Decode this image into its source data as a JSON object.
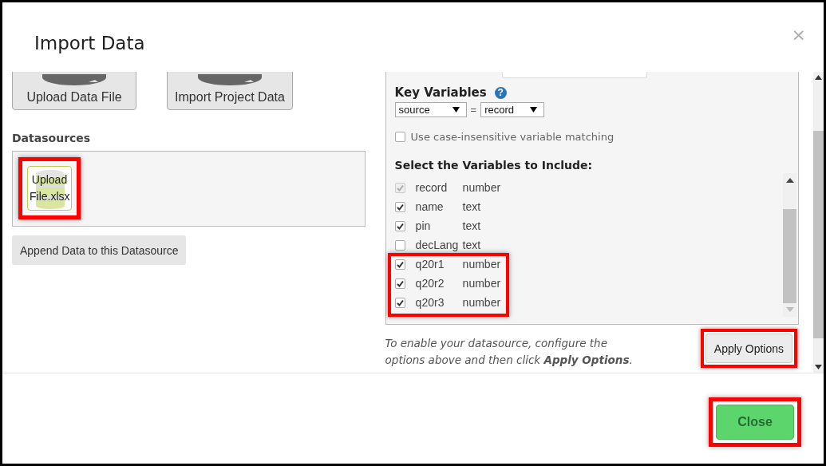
{
  "dialog": {
    "title": "Import Data",
    "close_icon": "×"
  },
  "import_buttons": [
    {
      "label": "Upload Data File"
    },
    {
      "label": "Import Project Data"
    }
  ],
  "datasources": {
    "heading": "Datasources",
    "items": [
      {
        "label": "Upload File.xlsx",
        "highlighted": true
      }
    ],
    "append_button": "Append Data to this Datasource"
  },
  "options": {
    "key_variables": {
      "label": "Key Variables",
      "help_icon": "?",
      "left": "source",
      "operator": "=",
      "right": "record"
    },
    "case_insensitive": {
      "label": "Use case-insensitive variable matching",
      "checked": false
    },
    "variables_heading": "Select the Variables to Include:",
    "variable_groups": [
      {
        "highlighted": false,
        "variables": [
          {
            "name": "record",
            "type": "number",
            "checked": true,
            "disabled": true
          },
          {
            "name": "name",
            "type": "text",
            "checked": true,
            "disabled": false
          },
          {
            "name": "pin",
            "type": "text",
            "checked": true,
            "disabled": false
          },
          {
            "name": "decLang",
            "type": "text",
            "checked": false,
            "disabled": false
          }
        ]
      },
      {
        "highlighted": true,
        "variables": [
          {
            "name": "q20r1",
            "type": "number",
            "checked": true,
            "disabled": false
          },
          {
            "name": "q20r2",
            "type": "number",
            "checked": true,
            "disabled": false
          },
          {
            "name": "q20r3",
            "type": "number",
            "checked": true,
            "disabled": false
          }
        ]
      }
    ],
    "hint": "To enable your datasource, configure the options above and then click **Apply Options**.",
    "apply_button": {
      "label": "Apply Options",
      "highlighted": true
    }
  },
  "footer": {
    "close_button": {
      "label": "Close",
      "highlighted": true
    }
  }
}
